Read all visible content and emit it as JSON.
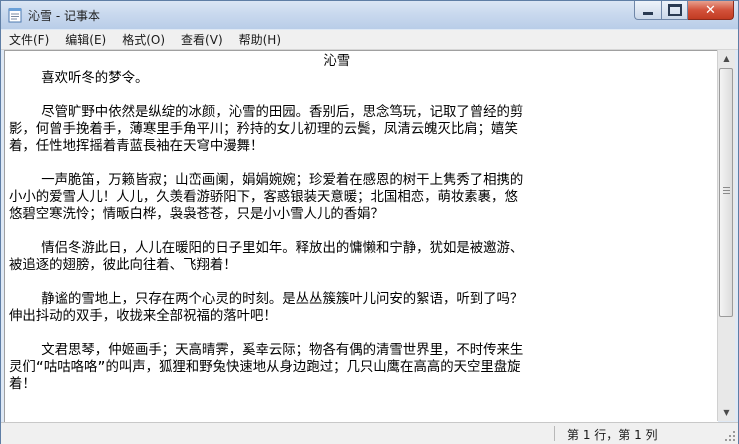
{
  "window": {
    "title": "沁雪 - 记事本",
    "icon": "notepad-icon",
    "buttons": {
      "minimize": "minimize-icon",
      "maximize": "maximize-icon",
      "close": "close-icon"
    }
  },
  "menu": {
    "items": [
      {
        "label": "文件(F)"
      },
      {
        "label": "编辑(E)"
      },
      {
        "label": "格式(O)"
      },
      {
        "label": "查看(V)"
      },
      {
        "label": "帮助(H)"
      }
    ]
  },
  "document": {
    "lines": [
      "                                       沁雪",
      "    喜欢听冬的梦令。",
      "",
      "    尽管旷野中依然是纵绽的冰颜，沁雪的田园。香别后，思念笃玩，记取了曾经的剪",
      "影，何曾手挽着手，薄寒里手角平川；矜持的女儿初理的云鬓，凤清云魄灭比肩；嬉笑",
      "着，任性地挥摇着青蓝長袖在天穹中漫舞！",
      "",
      "    一声脆笛，万籁皆寂；山峦画阑，娟娟婉婉；珍爱着在感恩的树干上隽秀了相携的",
      "小小的爱雪人儿！人儿，久羡看游骄阳下，客惑银装天意暖；北国相恋，萌妆素裹，悠",
      "悠碧空寒洗怜；情畈白桦，袅袅苍苍，只是小小雪人儿的香娟？",
      "",
      "    情侣冬游此日，人儿在暖阳的日子里如年。释放出的慵懒和宁静，犹如是被邀游、",
      "被追逐的翅膀，彼此向往着、飞翔着！",
      "",
      "    静谧的雪地上，只存在两个心灵的时刻。是丛丛簇簇叶儿问安的絮语，听到了吗？",
      "伸出抖动的双手，收拢来全部祝福的落叶吧！",
      "",
      "    文君思琴，仲姬画手；天高晴霁，奚幸云际；物各有偶的清雪世界里，不时传来生",
      "灵们“咕咕咯咯”的叫声，狐狸和野兔快速地从身边跑过；几只山鹰在高高的天空里盘旋",
      "着！"
    ]
  },
  "scrollbar": {
    "up": "scroll-up-arrow-icon",
    "down": "scroll-down-arrow-icon"
  },
  "status": {
    "position": "第 1 行，第 1 列"
  }
}
